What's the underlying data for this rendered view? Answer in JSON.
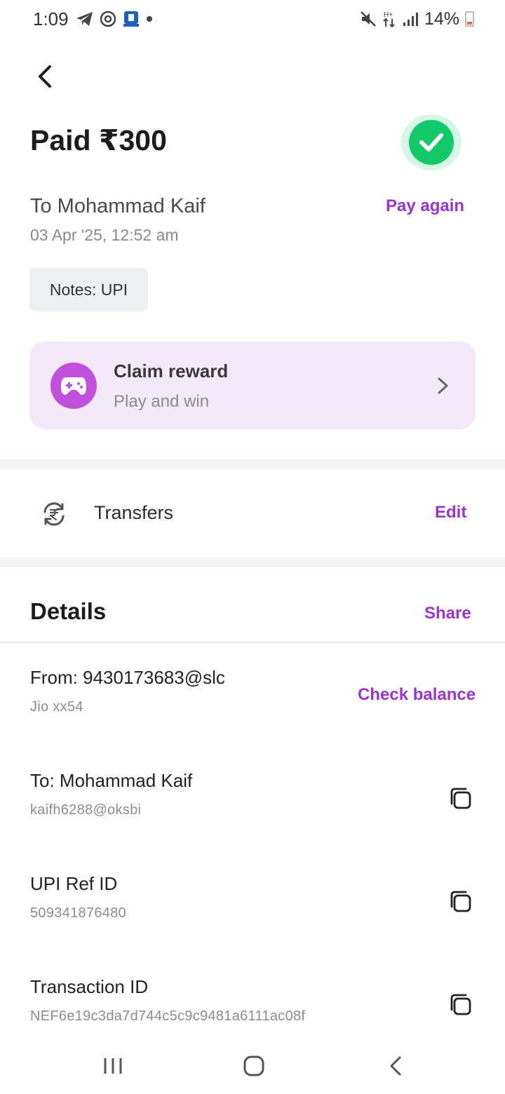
{
  "status_bar": {
    "time": "1:09",
    "battery": "14%",
    "icons_left": [
      "telegram-icon",
      "circle-app-icon",
      "bank-app-icon",
      "dot-icon"
    ],
    "icons_right": [
      "mute-icon",
      "data-arrows-icon",
      "signal-icon",
      "battery-icon"
    ]
  },
  "header": {
    "back_icon": "back-arrow-icon",
    "title": "Paid ₹300",
    "status_icon": "check-circle-icon",
    "status_color": "#14c96a"
  },
  "payment": {
    "to": "To Mohammad Kaif",
    "datetime": "03 Apr '25, 12:52 am",
    "pay_again": "Pay again",
    "notes": "Notes: UPI"
  },
  "reward": {
    "title": "Claim reward",
    "subtitle": "Play and win",
    "icon": "gamepad-icon"
  },
  "category": {
    "icon": "rupee-transfer-icon",
    "label": "Transfers",
    "edit": "Edit"
  },
  "details": {
    "title": "Details",
    "share": "Share",
    "rows": [
      {
        "main": "From: 9430173683@slc",
        "sub": "Jio xx54",
        "action": "Check balance"
      },
      {
        "main": "To: Mohammad Kaif",
        "sub": "kaifh6288@oksbi",
        "action_icon": "copy-icon"
      },
      {
        "main": "UPI Ref ID",
        "sub": "509341876480",
        "action_icon": "copy-icon"
      },
      {
        "main": "Transaction ID",
        "sub": "NEF6e19c3da7d744c5c9c9481a6111ac08f",
        "action_icon": "copy-icon"
      }
    ]
  },
  "colors": {
    "accent": "#9b33cf",
    "reward_bg": "#f5e8fa",
    "reward_icon_bg": "#c151dc"
  },
  "nav_bar": [
    "recent-apps-icon",
    "home-icon",
    "back-icon"
  ]
}
